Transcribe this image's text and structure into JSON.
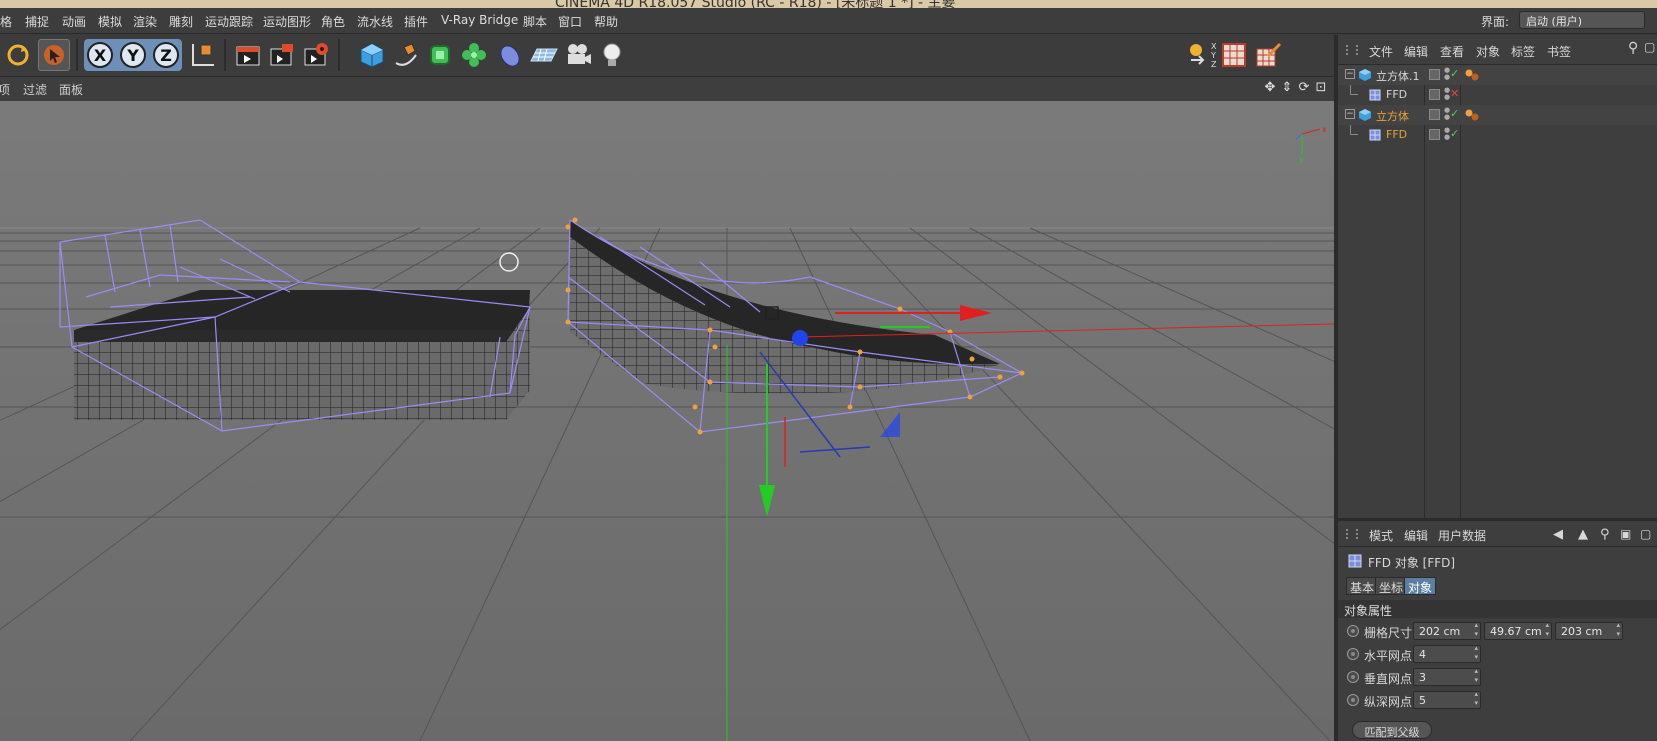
{
  "window": {
    "title": "CINEMA 4D R18.057 Studio (RC - R18) - [未标题 1 *] - 主要"
  },
  "menubar": {
    "items": [
      "格",
      "捕捉",
      "动画",
      "模拟",
      "渲染",
      "雕刻",
      "运动跟踪",
      "运动图形",
      "角色",
      "流水线",
      "插件",
      "V-Ray Bridge",
      "脚本",
      "窗口",
      "帮助"
    ],
    "layout_label": "界面:",
    "layout_value": "启动 (用户)"
  },
  "toolbar": {
    "icons": [
      "undo-icon",
      "select-arrow-icon",
      "x-axis-icon",
      "y-axis-icon",
      "z-axis-icon",
      "coordinate-system-icon",
      "render-view-icon",
      "render-picture-viewer-icon",
      "render-settings-icon",
      "cube-primitive-icon",
      "pen-spline-icon",
      "subdivision-surface-icon",
      "cloner-icon",
      "deformer-bend-icon",
      "floor-plane-icon",
      "camera-icon",
      "light-bulb-icon",
      "snap-axis-icon",
      "checker-texture-icon",
      "paint-brush-icon"
    ],
    "axis_labels": {
      "x": "X",
      "y": "Y",
      "z": "Z"
    }
  },
  "viewport": {
    "menu": [
      "项",
      "过滤",
      "面板"
    ],
    "nav_icons": [
      "move-view-icon",
      "zoom-view-icon",
      "rotate-view-icon",
      "maximize-view-icon"
    ]
  },
  "object_manager": {
    "menu": [
      "文件",
      "编辑",
      "查看",
      "对象",
      "标签",
      "书签"
    ],
    "objects": [
      {
        "name": "立方体.1",
        "type": "cube",
        "indent": 0,
        "color": "#d8d8d8",
        "check": "✓",
        "check_color": "#5ec95e"
      },
      {
        "name": "FFD",
        "type": "ffd",
        "indent": 1,
        "color": "#d8d8d8",
        "check": "✕",
        "check_color": "#e04545"
      },
      {
        "name": "立方体",
        "type": "cube",
        "indent": 0,
        "color": "#e8a23a",
        "check": "✓",
        "check_color": "#5ec95e"
      },
      {
        "name": "FFD",
        "type": "ffd",
        "indent": 1,
        "color": "#e8a23a",
        "check": "✓",
        "check_color": "#5ec95e"
      }
    ]
  },
  "attribute_manager": {
    "menu": [
      "模式",
      "编辑",
      "用户数据"
    ],
    "title": "FFD 对象 [FFD]",
    "tabs": [
      "基本",
      "坐标",
      "对象"
    ],
    "active_tab": 2,
    "section": "对象属性",
    "grid_size_label": "栅格尺寸",
    "grid_size": [
      "202 cm",
      "49.67 cm",
      "203 cm"
    ],
    "horizontal_points_label": "水平网点",
    "horizontal_points": "4",
    "vertical_points_label": "垂直网点",
    "vertical_points": "3",
    "depth_points_label": "纵深网点",
    "depth_points": "5",
    "fit_button": "匹配到父级"
  },
  "colors": {
    "lattice": "#9b8cf5",
    "point": "#f0a040",
    "x_axis": "#e02020",
    "y_axis": "#22cc22",
    "z_axis": "#2244ee",
    "accent_tab": "#5b7ea3"
  }
}
